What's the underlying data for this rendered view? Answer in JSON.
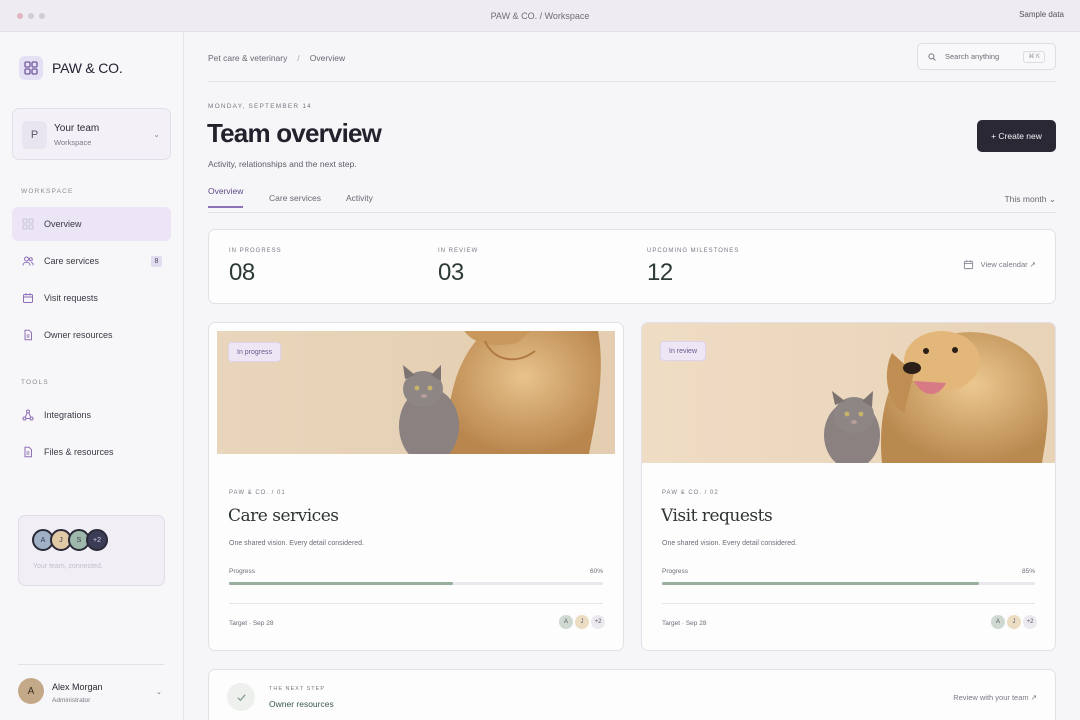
{
  "window": {
    "title": "PAW & CO. / Workspace",
    "badge": "Sample data"
  },
  "brand": {
    "name": "PAW & CO.",
    "icon": "grid-icon"
  },
  "team": {
    "initial": "P",
    "name": "Your team",
    "sub": "Workspace",
    "chevron": "⌄"
  },
  "sidebar": {
    "workspace_label": "WORKSPACE",
    "tools_label": "TOOLS",
    "items": [
      {
        "label": "Overview",
        "icon": "grid-icon"
      },
      {
        "label": "Care services",
        "icon": "users-icon",
        "badge": "8"
      },
      {
        "label": "Visit requests",
        "icon": "calendar-icon"
      },
      {
        "label": "Owner resources",
        "icon": "document-icon"
      }
    ],
    "tools": [
      {
        "label": "Integrations",
        "icon": "nodes-icon"
      },
      {
        "label": "Files & resources",
        "icon": "file-icon"
      }
    ],
    "connect": {
      "avatars": [
        "A",
        "J",
        "S",
        "+2"
      ],
      "text": "Your team, connected."
    },
    "user": {
      "initial": "A",
      "name": "Alex Morgan",
      "role": "Administrator",
      "chevron": "⌄"
    }
  },
  "breadcrumb": {
    "parent": "Pet care & veterinary",
    "separator": "/",
    "current": "Overview"
  },
  "search": {
    "placeholder": "Search anything",
    "shortcut": "⌘ K"
  },
  "header": {
    "date": "MONDAY, SEPTEMBER 14",
    "title": "Team overview",
    "subtitle": "Activity, relationships and the next step.",
    "create_label": "+ Create new"
  },
  "tabs": [
    "Overview",
    "Care services",
    "Activity"
  ],
  "period": "This month ⌄",
  "stats": [
    {
      "label": "IN PROGRESS",
      "value": "08"
    },
    {
      "label": "IN REVIEW",
      "value": "03"
    },
    {
      "label": "UPCOMING MILESTONES",
      "value": "12"
    }
  ],
  "view_calendar": "View calendar ↗",
  "cards": [
    {
      "status": "In progress",
      "eyebrow": "PAW & CO. / 01",
      "title": "Care services",
      "desc": "One shared vision. Every detail considered.",
      "progress_label": "Progress",
      "progress_text": "60%",
      "progress": 0.6,
      "target": "Target · Sep 28",
      "avatars": [
        "A",
        "J",
        "+2"
      ]
    },
    {
      "status": "In review",
      "eyebrow": "PAW & CO. / 02",
      "title": "Visit requests",
      "desc": "One shared vision. Every detail considered.",
      "progress_label": "Progress",
      "progress_text": "85%",
      "progress": 0.85,
      "target": "Target · Sep 28",
      "avatars": [
        "A",
        "J",
        "+2"
      ]
    }
  ],
  "next_step": {
    "eyebrow": "THE NEXT STEP",
    "title": "Owner resources",
    "link": "Review with your team ↗"
  },
  "colors": {
    "accent": "#8b73b8",
    "primary_button": "#2a2835",
    "progress": "#98ae9c"
  }
}
